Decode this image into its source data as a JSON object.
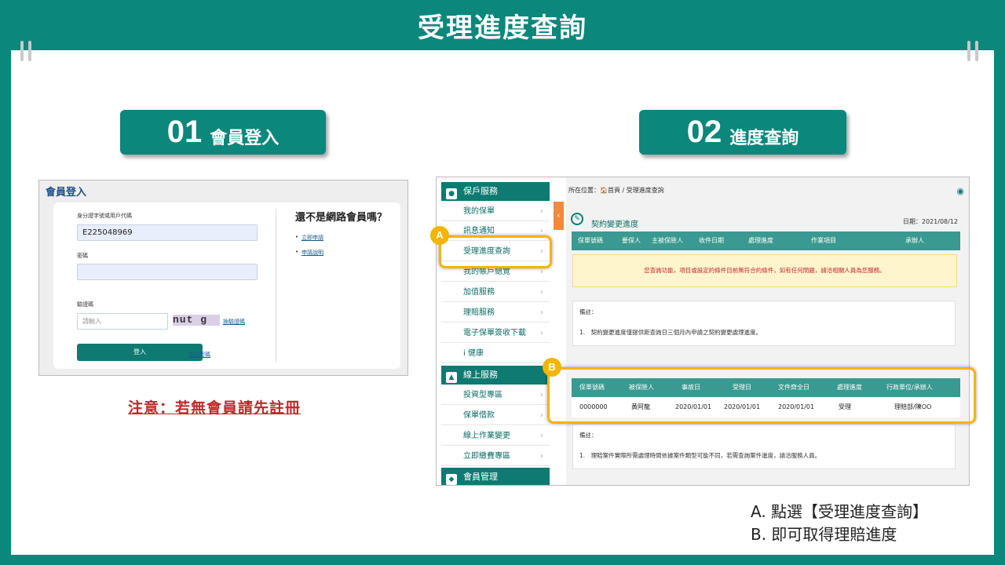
{
  "title": "受理進度查詢",
  "steps": [
    {
      "num": "01",
      "label": "會員登入"
    },
    {
      "num": "02",
      "label": "進度查詢"
    }
  ],
  "login": {
    "header": "會員登入",
    "id_label": "身分證字號或用戶代碼",
    "id_value": "E225048969",
    "password_label": "密碼",
    "password_value": "",
    "captcha_label": "驗證碼",
    "captcha_placeholder": "請輸入",
    "captcha_text": "nut g",
    "refresh_captcha": "換驗證碼",
    "login_button": "登入",
    "forgot_password": "忘記密碼",
    "not_member": "還不是網路會員嗎？",
    "links": [
      "立即申請",
      "申請說明"
    ]
  },
  "notice": "注意：若無會員請先註冊",
  "progress": {
    "breadcrumb": "所在位置：🏠首頁 / 受理進度查詢",
    "sidebar": {
      "group1": "保戶服務",
      "items1": [
        "我的保單",
        "訊息通知",
        "受理進度查詢",
        "我的帳戶總覽",
        "加值服務",
        "理賠服務",
        "電子保單簽收下載",
        "i 健康"
      ],
      "group2": "線上服務",
      "items2": [
        "投資型專區",
        "保單借款",
        "線上作業變更",
        "立即繳費專區"
      ],
      "group3": "會員管理"
    },
    "section_title": "契約變更進度",
    "date": "日期：2021/08/12",
    "table1_headers": [
      "保單號碼",
      "要保人",
      "主被保險人",
      "收件日期",
      "處理進度",
      "作業項目",
      "承辦人"
    ],
    "warning": "您查詢功能，項目或設定的條件目前無符合的條件，如有任何問題，請洽相關人員為您服務。",
    "note1_title": "備註：",
    "note1_text": "1.　契約變更進度僅提供距查詢日三個月內申請之契約變更處理進度。",
    "table2_headers": [
      "保單號碼",
      "被保險人",
      "事故日",
      "受理日",
      "文件齊全日",
      "處理進度",
      "行政單位/承辦人"
    ],
    "table2_row": [
      "0000000",
      "黃阿龍",
      "2020/01/01",
      "2020/01/01",
      "2020/01/01",
      "受理",
      "理賠部/陳OO"
    ],
    "note2_title": "備註：",
    "note2_text": "1.　理賠案件實際所需處理時間依據案件類型可能不同，若需查詢案件進度，請洽服務人員。"
  },
  "markers": [
    "A",
    "B"
  ],
  "legend": [
    "A. 點選【受理進度查詢】",
    "B. 即可取得理賠進度"
  ],
  "colors": {
    "teal": "#0b877c",
    "highlight": "#f4b400",
    "warning_text": "#c0282a"
  }
}
